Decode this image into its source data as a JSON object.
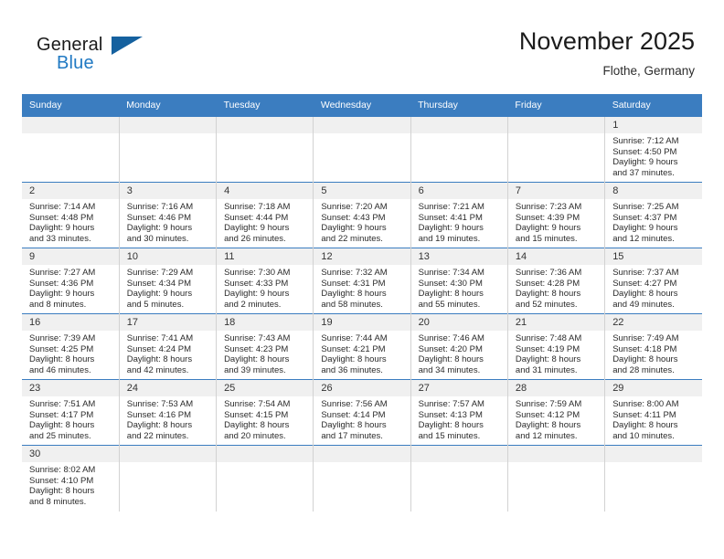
{
  "brand": {
    "logo_text_top": "General",
    "logo_text_bottom": "Blue",
    "accent_color": "#2079c3",
    "flag_color": "#15619f",
    "flag_icon": "triangle-flag-icon"
  },
  "header": {
    "month_title": "November 2025",
    "location": "Flothe, Germany"
  },
  "theme": {
    "header_row_bg": "#3b7dc0",
    "header_row_text": "#ffffff",
    "daynum_bg": "#f0f0f0",
    "row_divider": "#3b7dc0",
    "cell_divider": "#d2d2d2"
  },
  "weekday_headers": [
    "Sunday",
    "Monday",
    "Tuesday",
    "Wednesday",
    "Thursday",
    "Friday",
    "Saturday"
  ],
  "labels": {
    "sunrise_prefix": "Sunrise:",
    "sunset_prefix": "Sunset:",
    "daylight_prefix": "Daylight:"
  },
  "weeks": [
    [
      {
        "blank": true
      },
      {
        "blank": true
      },
      {
        "blank": true
      },
      {
        "blank": true
      },
      {
        "blank": true
      },
      {
        "blank": true
      },
      {
        "day": "1",
        "sunrise": "Sunrise: 7:12 AM",
        "sunset": "Sunset: 4:50 PM",
        "daylight_1": "Daylight: 9 hours",
        "daylight_2": "and 37 minutes."
      }
    ],
    [
      {
        "day": "2",
        "sunrise": "Sunrise: 7:14 AM",
        "sunset": "Sunset: 4:48 PM",
        "daylight_1": "Daylight: 9 hours",
        "daylight_2": "and 33 minutes."
      },
      {
        "day": "3",
        "sunrise": "Sunrise: 7:16 AM",
        "sunset": "Sunset: 4:46 PM",
        "daylight_1": "Daylight: 9 hours",
        "daylight_2": "and 30 minutes."
      },
      {
        "day": "4",
        "sunrise": "Sunrise: 7:18 AM",
        "sunset": "Sunset: 4:44 PM",
        "daylight_1": "Daylight: 9 hours",
        "daylight_2": "and 26 minutes."
      },
      {
        "day": "5",
        "sunrise": "Sunrise: 7:20 AM",
        "sunset": "Sunset: 4:43 PM",
        "daylight_1": "Daylight: 9 hours",
        "daylight_2": "and 22 minutes."
      },
      {
        "day": "6",
        "sunrise": "Sunrise: 7:21 AM",
        "sunset": "Sunset: 4:41 PM",
        "daylight_1": "Daylight: 9 hours",
        "daylight_2": "and 19 minutes."
      },
      {
        "day": "7",
        "sunrise": "Sunrise: 7:23 AM",
        "sunset": "Sunset: 4:39 PM",
        "daylight_1": "Daylight: 9 hours",
        "daylight_2": "and 15 minutes."
      },
      {
        "day": "8",
        "sunrise": "Sunrise: 7:25 AM",
        "sunset": "Sunset: 4:37 PM",
        "daylight_1": "Daylight: 9 hours",
        "daylight_2": "and 12 minutes."
      }
    ],
    [
      {
        "day": "9",
        "sunrise": "Sunrise: 7:27 AM",
        "sunset": "Sunset: 4:36 PM",
        "daylight_1": "Daylight: 9 hours",
        "daylight_2": "and 8 minutes."
      },
      {
        "day": "10",
        "sunrise": "Sunrise: 7:29 AM",
        "sunset": "Sunset: 4:34 PM",
        "daylight_1": "Daylight: 9 hours",
        "daylight_2": "and 5 minutes."
      },
      {
        "day": "11",
        "sunrise": "Sunrise: 7:30 AM",
        "sunset": "Sunset: 4:33 PM",
        "daylight_1": "Daylight: 9 hours",
        "daylight_2": "and 2 minutes."
      },
      {
        "day": "12",
        "sunrise": "Sunrise: 7:32 AM",
        "sunset": "Sunset: 4:31 PM",
        "daylight_1": "Daylight: 8 hours",
        "daylight_2": "and 58 minutes."
      },
      {
        "day": "13",
        "sunrise": "Sunrise: 7:34 AM",
        "sunset": "Sunset: 4:30 PM",
        "daylight_1": "Daylight: 8 hours",
        "daylight_2": "and 55 minutes."
      },
      {
        "day": "14",
        "sunrise": "Sunrise: 7:36 AM",
        "sunset": "Sunset: 4:28 PM",
        "daylight_1": "Daylight: 8 hours",
        "daylight_2": "and 52 minutes."
      },
      {
        "day": "15",
        "sunrise": "Sunrise: 7:37 AM",
        "sunset": "Sunset: 4:27 PM",
        "daylight_1": "Daylight: 8 hours",
        "daylight_2": "and 49 minutes."
      }
    ],
    [
      {
        "day": "16",
        "sunrise": "Sunrise: 7:39 AM",
        "sunset": "Sunset: 4:25 PM",
        "daylight_1": "Daylight: 8 hours",
        "daylight_2": "and 46 minutes."
      },
      {
        "day": "17",
        "sunrise": "Sunrise: 7:41 AM",
        "sunset": "Sunset: 4:24 PM",
        "daylight_1": "Daylight: 8 hours",
        "daylight_2": "and 42 minutes."
      },
      {
        "day": "18",
        "sunrise": "Sunrise: 7:43 AM",
        "sunset": "Sunset: 4:23 PM",
        "daylight_1": "Daylight: 8 hours",
        "daylight_2": "and 39 minutes."
      },
      {
        "day": "19",
        "sunrise": "Sunrise: 7:44 AM",
        "sunset": "Sunset: 4:21 PM",
        "daylight_1": "Daylight: 8 hours",
        "daylight_2": "and 36 minutes."
      },
      {
        "day": "20",
        "sunrise": "Sunrise: 7:46 AM",
        "sunset": "Sunset: 4:20 PM",
        "daylight_1": "Daylight: 8 hours",
        "daylight_2": "and 34 minutes."
      },
      {
        "day": "21",
        "sunrise": "Sunrise: 7:48 AM",
        "sunset": "Sunset: 4:19 PM",
        "daylight_1": "Daylight: 8 hours",
        "daylight_2": "and 31 minutes."
      },
      {
        "day": "22",
        "sunrise": "Sunrise: 7:49 AM",
        "sunset": "Sunset: 4:18 PM",
        "daylight_1": "Daylight: 8 hours",
        "daylight_2": "and 28 minutes."
      }
    ],
    [
      {
        "day": "23",
        "sunrise": "Sunrise: 7:51 AM",
        "sunset": "Sunset: 4:17 PM",
        "daylight_1": "Daylight: 8 hours",
        "daylight_2": "and 25 minutes."
      },
      {
        "day": "24",
        "sunrise": "Sunrise: 7:53 AM",
        "sunset": "Sunset: 4:16 PM",
        "daylight_1": "Daylight: 8 hours",
        "daylight_2": "and 22 minutes."
      },
      {
        "day": "25",
        "sunrise": "Sunrise: 7:54 AM",
        "sunset": "Sunset: 4:15 PM",
        "daylight_1": "Daylight: 8 hours",
        "daylight_2": "and 20 minutes."
      },
      {
        "day": "26",
        "sunrise": "Sunrise: 7:56 AM",
        "sunset": "Sunset: 4:14 PM",
        "daylight_1": "Daylight: 8 hours",
        "daylight_2": "and 17 minutes."
      },
      {
        "day": "27",
        "sunrise": "Sunrise: 7:57 AM",
        "sunset": "Sunset: 4:13 PM",
        "daylight_1": "Daylight: 8 hours",
        "daylight_2": "and 15 minutes."
      },
      {
        "day": "28",
        "sunrise": "Sunrise: 7:59 AM",
        "sunset": "Sunset: 4:12 PM",
        "daylight_1": "Daylight: 8 hours",
        "daylight_2": "and 12 minutes."
      },
      {
        "day": "29",
        "sunrise": "Sunrise: 8:00 AM",
        "sunset": "Sunset: 4:11 PM",
        "daylight_1": "Daylight: 8 hours",
        "daylight_2": "and 10 minutes."
      }
    ],
    [
      {
        "day": "30",
        "sunrise": "Sunrise: 8:02 AM",
        "sunset": "Sunset: 4:10 PM",
        "daylight_1": "Daylight: 8 hours",
        "daylight_2": "and 8 minutes."
      },
      {
        "blank": true
      },
      {
        "blank": true
      },
      {
        "blank": true
      },
      {
        "blank": true
      },
      {
        "blank": true
      },
      {
        "blank": true
      }
    ]
  ]
}
